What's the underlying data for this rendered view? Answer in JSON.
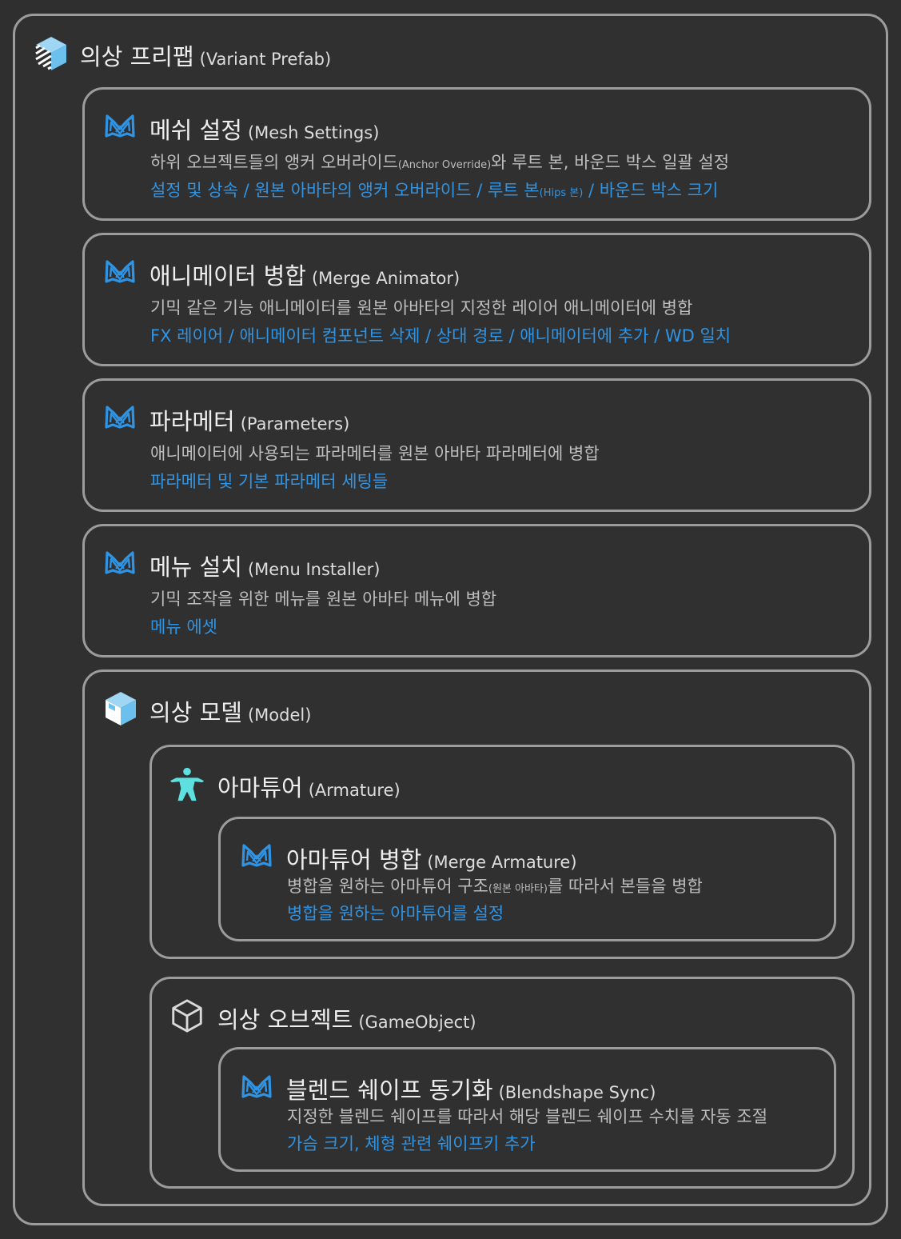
{
  "colors": {
    "background": "#2f2f2f",
    "border": "#9c9c9c",
    "link": "#2f94e4",
    "icon_blue": "#2f94e4",
    "icon_cyan": "#5ee0e0"
  },
  "root": {
    "title": "의상 프리팹",
    "sub": "(Variant Prefab)",
    "icon": "prefab-variant-icon"
  },
  "mesh": {
    "title": "메쉬 설정",
    "sub": "(Mesh Settings)",
    "icon": "ma-logo-icon",
    "desc_a": "하위 오브젝트들의 앵커 오버라이드",
    "desc_small": "(Anchor Override)",
    "desc_b": "와 루트 본, 바운드 박스 일괄 설정",
    "link_a": "설정 및 상속 / 원본 아바타의 앵커 오버라이드 / 루트 본",
    "link_small": "(Hips 본)",
    "link_b": " / 바운드 박스 크기"
  },
  "merge_animator": {
    "title": "애니메이터 병합",
    "sub": "(Merge Animator)",
    "icon": "ma-logo-icon",
    "desc": "기믹 같은 기능 애니메이터를 원본 아바타의 지정한 레이어 애니메이터에 병합",
    "link": "FX 레이어 / 애니메이터 컴포넌트 삭제 / 상대 경로 / 애니메이터에 추가 / WD 일치"
  },
  "parameters": {
    "title": "파라메터",
    "sub": "(Parameters)",
    "icon": "ma-logo-icon",
    "desc": "애니메이터에 사용되는 파라메터를 원본 아바타 파라메터에 병합",
    "link": "파라메터 및 기본 파라메터 세팅들"
  },
  "menu": {
    "title": "메뉴 설치",
    "sub": "(Menu Installer)",
    "icon": "ma-logo-icon",
    "desc": "기믹 조작을 위한 메뉴를 원본 아바타 메뉴에 병합",
    "link": "메뉴 에셋"
  },
  "model": {
    "title": "의상 모델",
    "sub": "(Model)",
    "icon": "prefab-icon"
  },
  "armature": {
    "title": "아마튜어",
    "sub": "(Armature)",
    "icon": "avatar-icon"
  },
  "merge_armature": {
    "title": "아마튜어 병합",
    "sub": "(Merge Armature)",
    "icon": "ma-logo-icon",
    "desc_a": "병합을 원하는 아마튜어 구조",
    "desc_small": "(원본 아바타)",
    "desc_b": "를 따라서 본들을 병합",
    "link": "병합을 원하는 아마튜어를 설정"
  },
  "gameobject": {
    "title": "의상 오브젝트",
    "sub": "(GameObject)",
    "icon": "gameobject-icon"
  },
  "blendshape": {
    "title": "블렌드 쉐이프 동기화",
    "sub": "(Blendshape Sync)",
    "icon": "ma-logo-icon",
    "desc": "지정한 블렌드 쉐이프를 따라서 해당 블렌드 쉐이프 수치를 자동 조절",
    "link": "가슴 크기, 체형 관련 쉐이프키 추가"
  }
}
